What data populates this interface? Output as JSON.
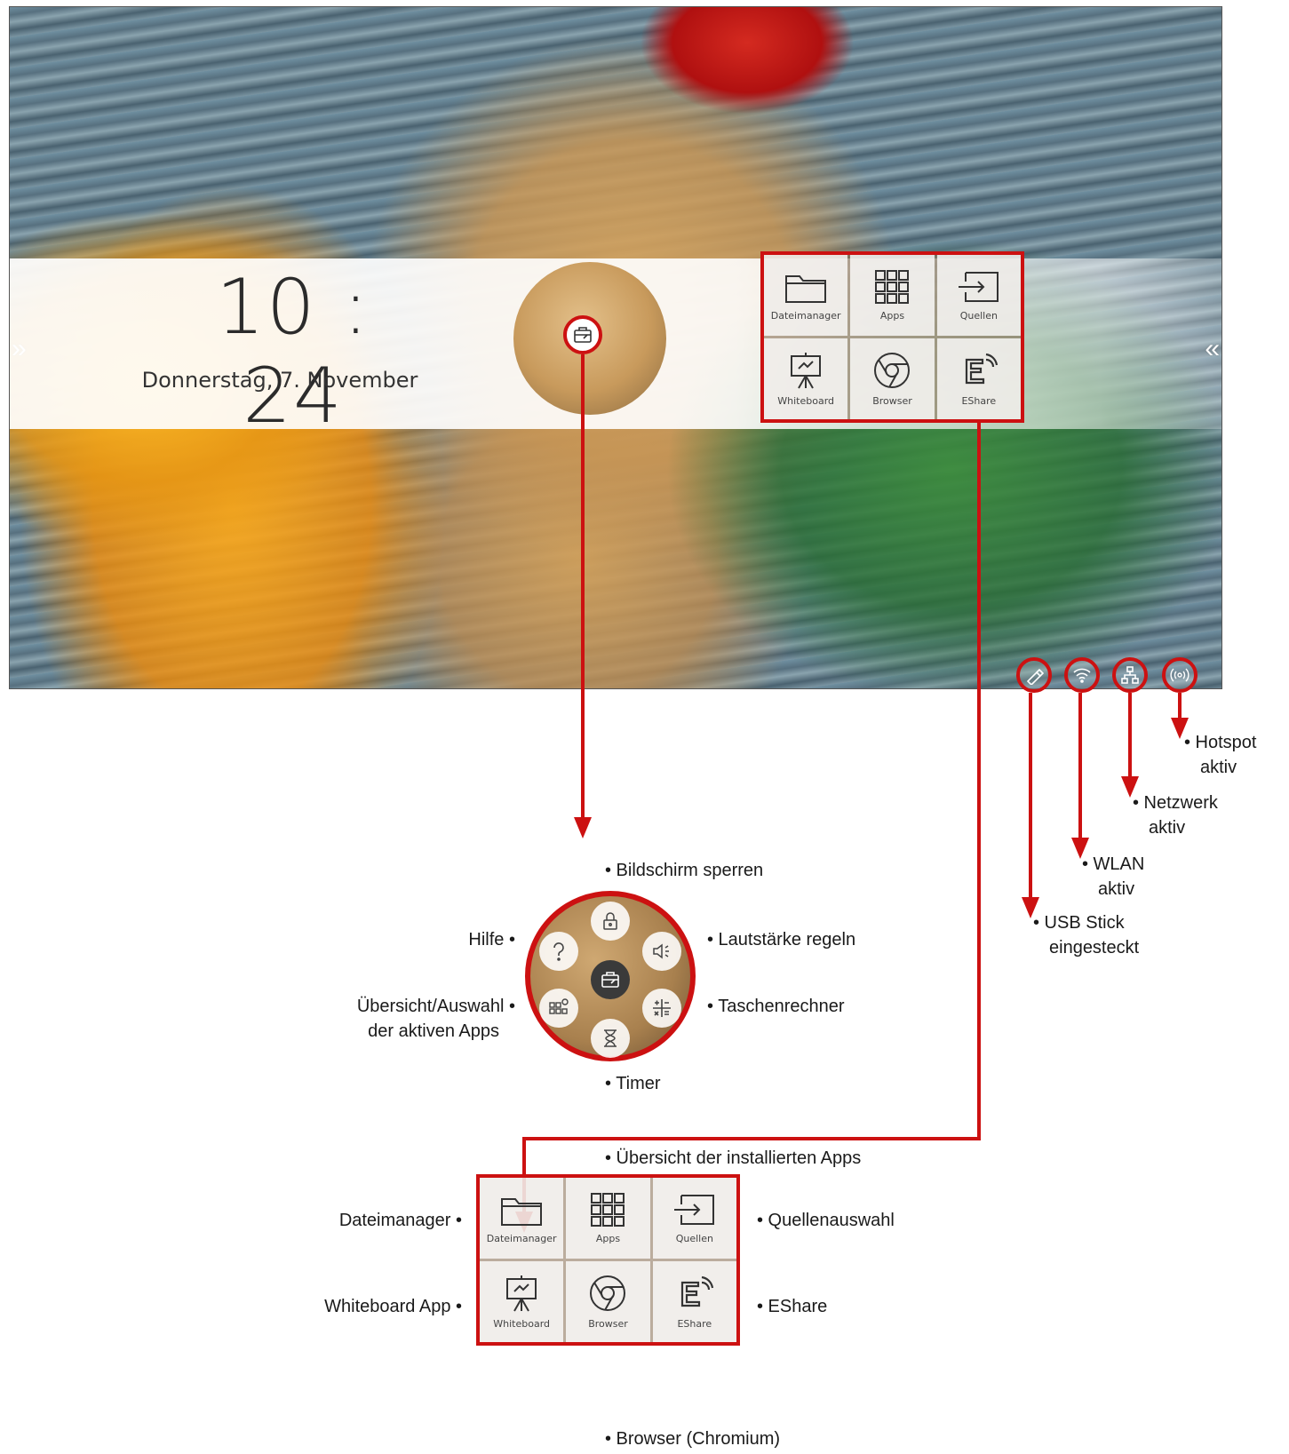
{
  "screen": {
    "clock": "10 : 24",
    "date": "Donnerstag, 7. November",
    "edge_left_arrow": "»",
    "edge_right_arrow": "«"
  },
  "tiles": [
    {
      "label": "Dateimanager",
      "icon": "folder-icon"
    },
    {
      "label": "Apps",
      "icon": "apps-grid-icon"
    },
    {
      "label": "Quellen",
      "icon": "source-input-icon"
    },
    {
      "label": "Whiteboard",
      "icon": "whiteboard-icon"
    },
    {
      "label": "Browser",
      "icon": "chrome-icon"
    },
    {
      "label": "EShare",
      "icon": "eshare-icon"
    }
  ],
  "status_icons": [
    "usb-stick-icon",
    "wifi-icon",
    "network-icon",
    "hotspot-icon"
  ],
  "annotations": {
    "hotspot": [
      "• Hotspot",
      "aktiv"
    ],
    "netzwerk": [
      "• Netzwerk",
      "aktiv"
    ],
    "wlan": [
      "• WLAN",
      "aktiv"
    ],
    "usb": [
      "• USB Stick",
      "eingesteckt"
    ],
    "bildschirm_sperren": "• Bildschirm sperren",
    "hilfe": "Hilfe •",
    "lautstaerke": "• Lautstärke regeln",
    "uebersicht_aktive": [
      "Übersicht/Auswahl •",
      "der aktiven Apps"
    ],
    "taschenrechner": "• Taschenrechner",
    "timer": "• Timer",
    "installierte_apps": "• Übersicht der installierten Apps",
    "dateimanager": "Dateimanager •",
    "quellenauswahl": "• Quellenauswahl",
    "whiteboard_app": "Whiteboard App •",
    "eshare": "• EShare",
    "browser": "• Browser (Chromium)"
  },
  "radial_menu": [
    "lock-icon",
    "volume-icon",
    "calculator-icon",
    "hourglass-icon",
    "active-apps-icon",
    "help-icon",
    "toolbox-icon"
  ],
  "colors": {
    "accent": "#cc1111"
  }
}
